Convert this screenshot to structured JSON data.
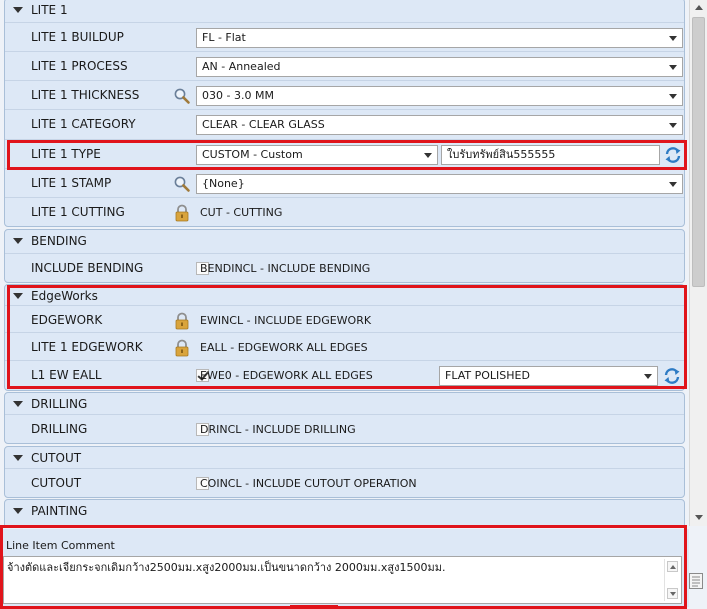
{
  "colors": {
    "highlight": "#e0141b",
    "panel": "#dde8f6",
    "panel_border": "#a9bfd8",
    "refresh_icon": "#2e7bc4",
    "lock_icon": "#d9a43c"
  },
  "lite1": {
    "header": "LITE 1",
    "buildup": {
      "label": "LITE 1 BUILDUP",
      "value": "FL - Flat"
    },
    "process": {
      "label": "LITE 1 PROCESS",
      "value": "AN - Annealed"
    },
    "thickness": {
      "label": "LITE 1 THICKNESS",
      "value": "030 - 3.0 MM",
      "icon": "search-icon"
    },
    "category": {
      "label": "LITE 1 CATEGORY",
      "value": "CLEAR - CLEAR GLASS"
    },
    "type": {
      "label": "LITE 1 TYPE",
      "value": "CUSTOM - Custom",
      "custom_text": "ใบรับทรัพย์สิน555555",
      "icon": "refresh-icon"
    },
    "stamp": {
      "label": "LITE 1 STAMP",
      "value": "{None}",
      "icon": "search-icon"
    },
    "cutting": {
      "label": "LITE 1 CUTTING",
      "value": "CUT - CUTTING",
      "icon": "lock-icon"
    }
  },
  "bending": {
    "header": "BENDING",
    "include": {
      "label": "INCLUDE BENDING",
      "value": "BENDINCL - INCLUDE BENDING",
      "checked": false
    }
  },
  "edgeworks": {
    "header": "EdgeWorks",
    "edgework": {
      "label": "EDGEWORK",
      "value": "EWINCL - INCLUDE EDGEWORK",
      "icon": "lock-icon"
    },
    "lite1_edgework": {
      "label": "LITE 1 EDGEWORK",
      "value": "EALL - EDGEWORK ALL EDGES",
      "icon": "lock-icon"
    },
    "ew_eall": {
      "label": "L1 EW EALL",
      "value": "EWE0 - EDGEWORK ALL EDGES",
      "checked": true,
      "finish": "FLAT POLISHED",
      "icon": "refresh-icon"
    }
  },
  "drilling": {
    "header": "DRILLING",
    "item": {
      "label": "DRILLING",
      "value": "DRINCL - INCLUDE DRILLING",
      "checked": false
    }
  },
  "cutout": {
    "header": "CUTOUT",
    "item": {
      "label": "CUTOUT",
      "value": "COINCL - INCLUDE CUTOUT OPERATION",
      "checked": false
    }
  },
  "painting": {
    "header": "PAINTING"
  },
  "comment": {
    "title": "Line Item Comment",
    "text": "จ้างตัดและเจียกระจกเดิมกว้าง2500มม.xสูง2000มม.เป็นขนาดกว้าง 2000มม.xสูง1500มม."
  }
}
